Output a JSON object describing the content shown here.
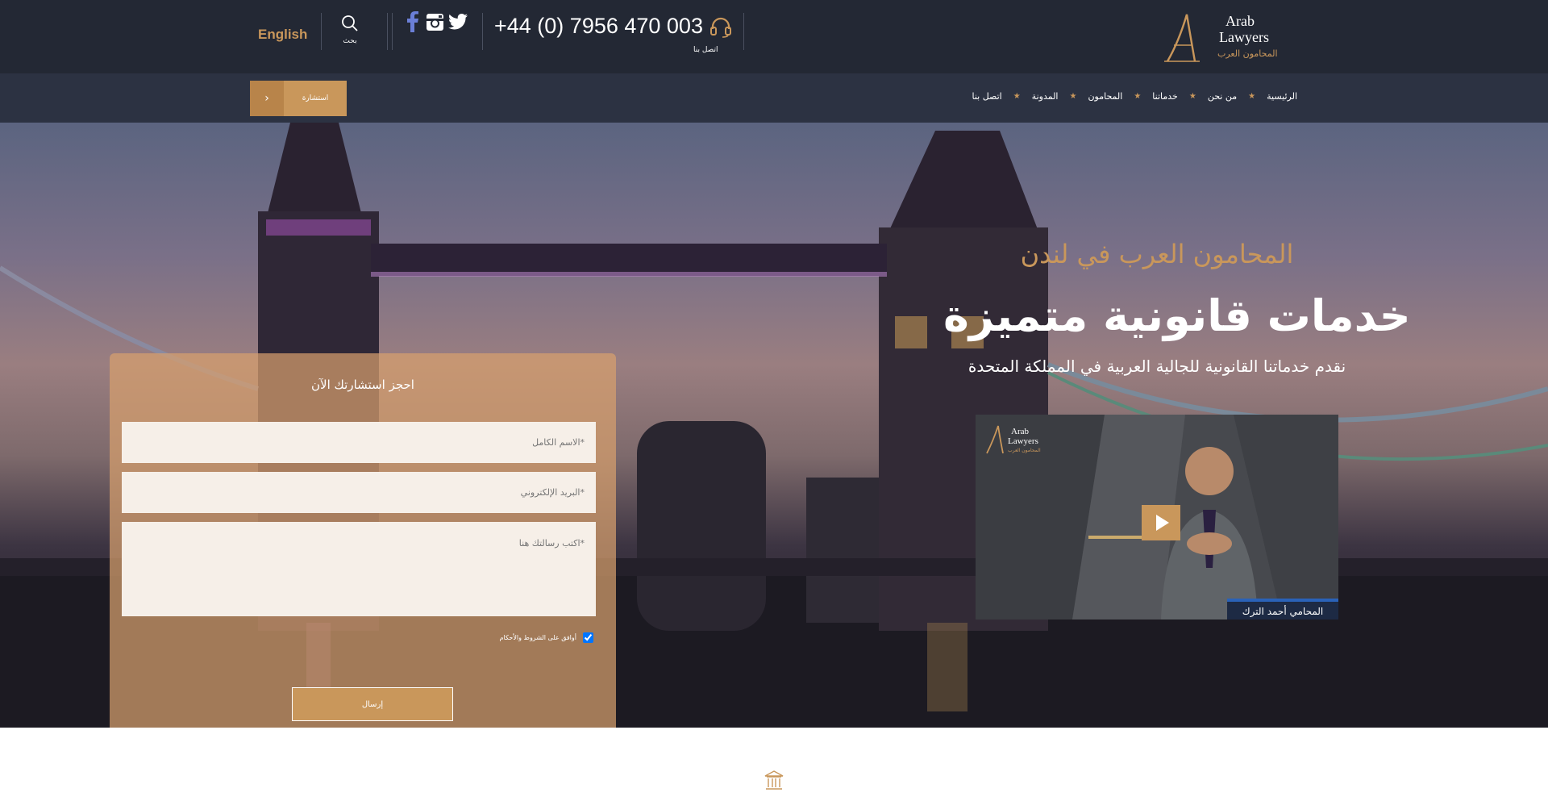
{
  "topbar": {
    "language_label": "English",
    "search_label": "بحث",
    "phone": "+44 (0) 7956 470 003",
    "call_label": "اتصل بنا",
    "logo_text": {
      "line1": "Arab",
      "line2": "Lawyers",
      "line3": "المحامون العرب",
      "letter": "A"
    }
  },
  "nav": {
    "items": [
      "الرئيسية",
      "من نحن",
      "خدماتنا",
      "المحامون",
      "المدونة",
      "اتصل بنا"
    ],
    "consult_button": "استشارة",
    "consult_arrow": "›"
  },
  "hero": {
    "eyebrow": "المحامون العرب في لندن",
    "title": "خدمات قانونية متميزة",
    "subtitle": "نقدم خدماتنا القانونية للجالية العربية في المملكة المتحدة"
  },
  "form": {
    "title": "احجز استشارتك الآن",
    "name_placeholder": "*الاسم الكامل",
    "email_placeholder": "*البريد الإلكتروني",
    "message_placeholder": "*اكتب رسالتك هنا",
    "consent_label": "أوافق على الشروط والأحكام",
    "consent_checked": true,
    "submit_label": "إرسال"
  },
  "video": {
    "logo_line1": "Arab",
    "logo_line2": "Lawyers",
    "logo_line3": "المحامون العرب",
    "caption": "المحامي أحمد الترك"
  },
  "colors": {
    "accent": "#c9975b",
    "topbar_bg": "#232834",
    "nav_bg": "#2c3242",
    "caption_bar": "#2a62b8"
  },
  "icons": [
    "search-icon",
    "facebook-icon",
    "instagram-icon",
    "twitter-icon",
    "headset-icon",
    "star-icon",
    "play-icon",
    "courthouse-icon"
  ]
}
